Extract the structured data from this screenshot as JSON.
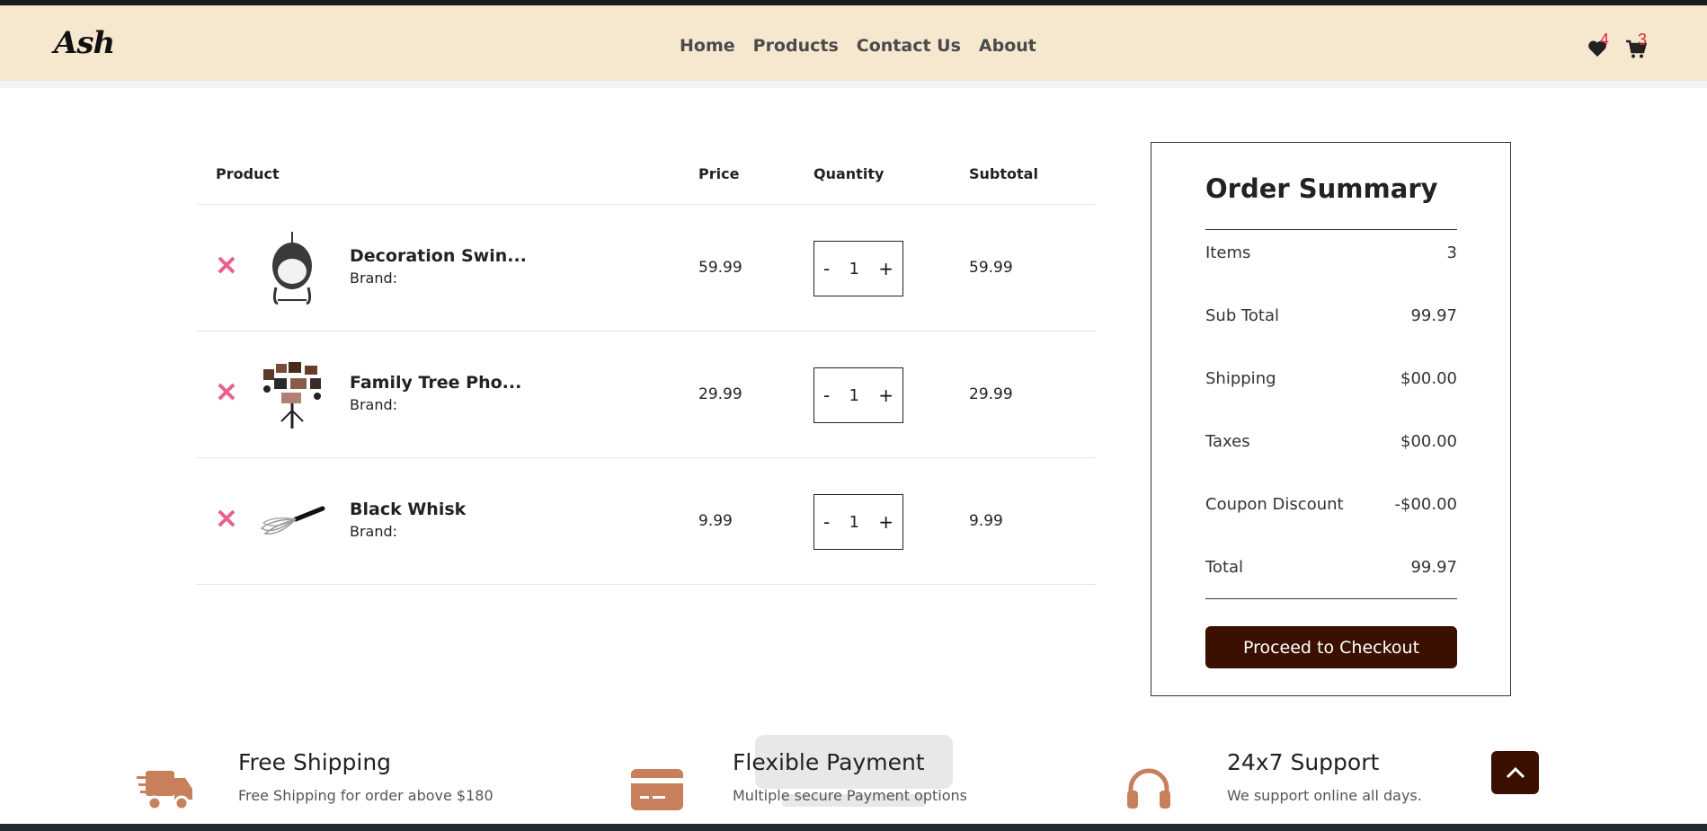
{
  "navbar": {
    "logo": "Ash",
    "links": [
      "Home",
      "Products",
      "Contact Us",
      "About"
    ],
    "wishlist_count": "4",
    "cart_count": "3"
  },
  "cart": {
    "headers": {
      "product": "Product",
      "price": "Price",
      "quantity": "Quantity",
      "subtotal": "Subtotal"
    },
    "items": [
      {
        "name": "Decoration Swin...",
        "brand": "Brand:",
        "price": "59.99",
        "quantity": "1",
        "subtotal": "59.99",
        "image": "swing-chair"
      },
      {
        "name": "Family Tree Pho...",
        "brand": "Brand:",
        "price": "29.99",
        "quantity": "1",
        "subtotal": "29.99",
        "image": "family-tree"
      },
      {
        "name": "Black Whisk",
        "brand": "Brand:",
        "price": "9.99",
        "quantity": "1",
        "subtotal": "9.99",
        "image": "whisk"
      }
    ],
    "minus": "-",
    "plus": "+",
    "remove": "✕"
  },
  "summary": {
    "title": "Order Summary",
    "rows": [
      {
        "label": "Items",
        "value": "3"
      },
      {
        "label": "Sub Total",
        "value": "99.97"
      },
      {
        "label": "Shipping",
        "value": "$00.00"
      },
      {
        "label": "Taxes",
        "value": "$00.00"
      },
      {
        "label": "Coupon Discount",
        "value": "-$00.00"
      },
      {
        "label": "Total",
        "value": "99.97"
      }
    ],
    "checkout_label": "Proceed to Checkout"
  },
  "features": [
    {
      "title": "Free Shipping",
      "desc": "Free Shipping for order above $180",
      "icon": "truck-icon"
    },
    {
      "title": "Flexible Payment",
      "desc": "Multiple secure Payment options",
      "icon": "card-icon"
    },
    {
      "title": "24x7 Support",
      "desc": "We support online all days.",
      "icon": "headphones-icon"
    }
  ],
  "colors": {
    "accent": "#3b1000",
    "navbar_bg": "#f6e7cf",
    "remove": "#e8618c",
    "badge": "#e0223a",
    "feature_icon": "#c8805c"
  }
}
